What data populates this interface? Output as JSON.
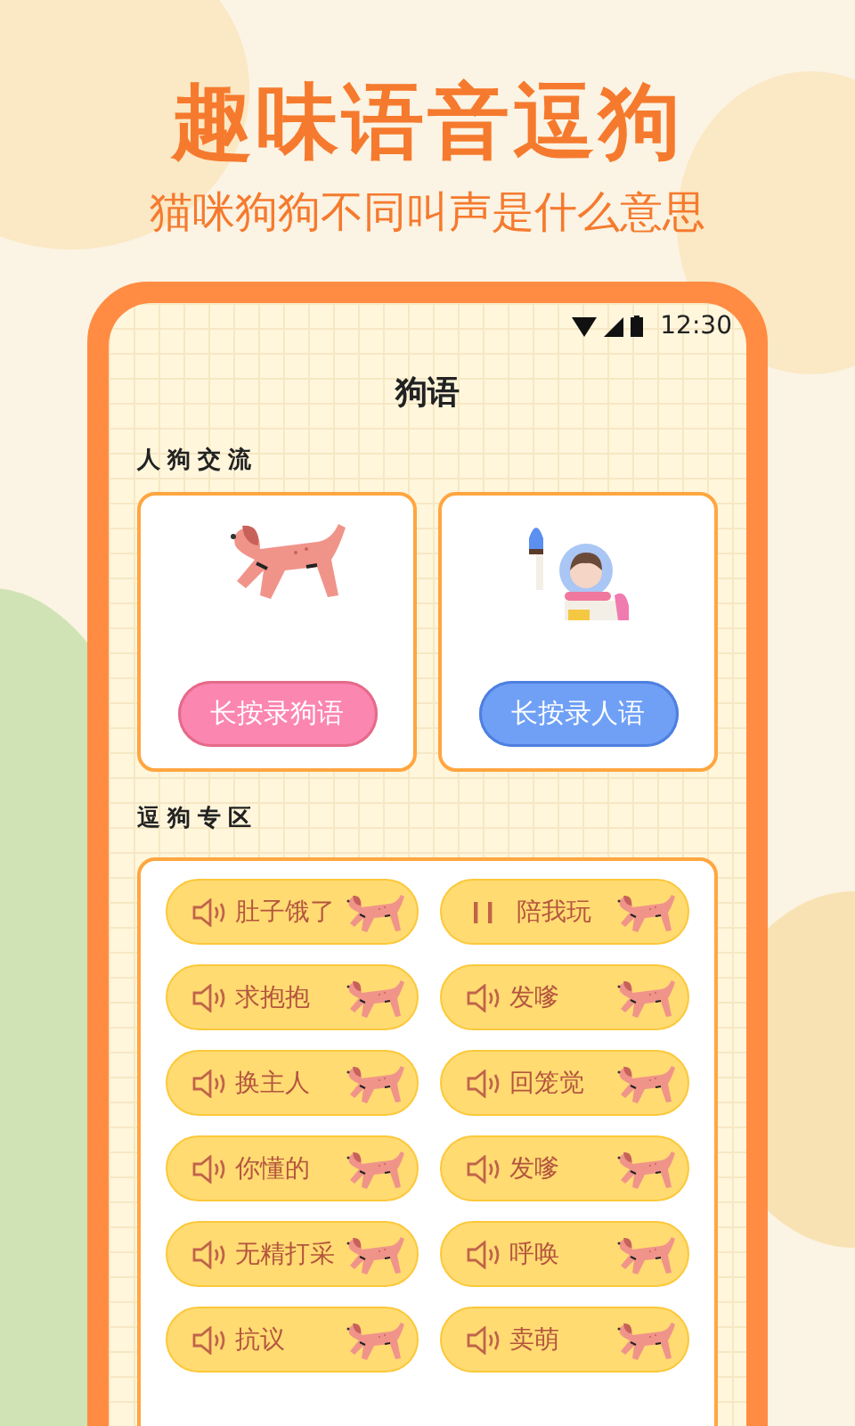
{
  "headline": "趣味语音逗狗",
  "subheadline": "猫咪狗狗不同叫声是什么意思",
  "status_bar": {
    "time": "12:30"
  },
  "screen_title": "狗语",
  "exchange": {
    "title": "人狗交流",
    "cards": [
      {
        "kind": "dog",
        "button": "长按录狗语"
      },
      {
        "kind": "person",
        "button": "长按录人语"
      }
    ]
  },
  "tease": {
    "title": "逗狗专区",
    "sounds": [
      {
        "label": "肚子饿了",
        "playing": false
      },
      {
        "label": "陪我玩",
        "playing": true
      },
      {
        "label": "求抱抱",
        "playing": false
      },
      {
        "label": "发嗲",
        "playing": false
      },
      {
        "label": "换主人",
        "playing": false
      },
      {
        "label": "回笼觉",
        "playing": false
      },
      {
        "label": "你懂的",
        "playing": false
      },
      {
        "label": "发嗲",
        "playing": false
      },
      {
        "label": "无精打采",
        "playing": false
      },
      {
        "label": "呼唤",
        "playing": false
      },
      {
        "label": "抗议",
        "playing": false
      },
      {
        "label": "卖萌",
        "playing": false
      }
    ]
  }
}
